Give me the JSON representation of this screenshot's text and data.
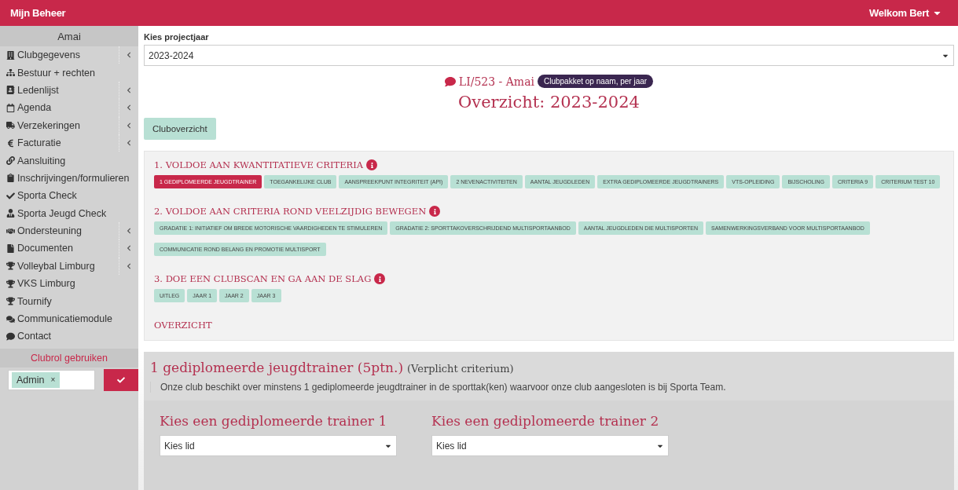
{
  "topbar": {
    "brand": "Mijn Beheer",
    "user": "Welkom Bert"
  },
  "sidebar": {
    "club": "Amai",
    "items": [
      {
        "label": "Clubgegevens",
        "expandable": true
      },
      {
        "label": "Bestuur + rechten",
        "expandable": false
      },
      {
        "label": "Ledenlijst",
        "expandable": true
      },
      {
        "label": "Agenda",
        "expandable": true
      },
      {
        "label": "Verzekeringen",
        "expandable": true
      },
      {
        "label": "Facturatie",
        "expandable": true
      },
      {
        "label": "Aansluiting",
        "expandable": false
      },
      {
        "label": "Inschrijvingen/formulieren",
        "expandable": false
      },
      {
        "label": "Sporta Check",
        "expandable": false
      },
      {
        "label": "Sporta Jeugd Check",
        "expandable": false
      },
      {
        "label": "Ondersteuning",
        "expandable": true
      },
      {
        "label": "Documenten",
        "expandable": true
      },
      {
        "label": "Volleybal Limburg",
        "expandable": true
      },
      {
        "label": "VKS Limburg",
        "expandable": false
      },
      {
        "label": "Tournify",
        "expandable": false
      },
      {
        "label": "Communicatiemodule",
        "expandable": false
      },
      {
        "label": "Contact",
        "expandable": false
      }
    ],
    "role": {
      "title": "Clubrol gebruiken",
      "tag": "Admin",
      "remove": "×"
    }
  },
  "year_select": {
    "label": "Kies projectjaar",
    "value": "2023-2024"
  },
  "club": {
    "code": "LI/523 - Amai",
    "badge": "Clubpakket op naam, per jaar",
    "title": "Overzicht: 2023-2024"
  },
  "overview_button": "Cluboverzicht",
  "sections": [
    {
      "title": "1. VOLDOE AAN KWANTITATIEVE CRITERIA",
      "info": true,
      "tags": [
        {
          "label": "1 GEDIPLOMEERDE JEUGDTRAINER",
          "selected": true
        },
        {
          "label": "TOEGANKELIJKE CLUB",
          "selected": false
        },
        {
          "label": "AANSPREEKPUNT INTEGRITEIT (API)",
          "selected": false
        },
        {
          "label": "2 NEVENACTIVITEITEN",
          "selected": false
        },
        {
          "label": "AANTAL JEUGDLEDEN",
          "selected": false
        },
        {
          "label": "EXTRA GEDIPLOMEERDE JEUGDTRAINERS",
          "selected": false
        },
        {
          "label": "VTS-OPLEIDING",
          "selected": false
        },
        {
          "label": "BIJSCHOLING",
          "selected": false
        },
        {
          "label": "CRITERIA 9",
          "selected": false
        },
        {
          "label": "CRITERIUM TEST 10",
          "selected": false
        }
      ]
    },
    {
      "title": "2. VOLDOE AAN CRITERIA ROND VEELZIJDIG BEWEGEN",
      "info": true,
      "tags": [
        {
          "label": "GRADATIE 1: INITIATIEF OM BREDE MOTORISCHE VAARDIGHEDEN TE STIMULEREN",
          "selected": false
        },
        {
          "label": "GRADATIE 2: SPORTTAKOVERSCHRIJDEND MULTISPORTAANBOD",
          "selected": false
        },
        {
          "label": "AANTAL JEUGDLEDEN DIE MULTISPORTEN",
          "selected": false
        },
        {
          "label": "SAMENWERKINGSVERBAND VOOR MULTISPORTAANBOD",
          "selected": false
        },
        {
          "label": "COMMUNICATIE ROND BELANG EN PROMOTIE MULTISPORT",
          "selected": false
        }
      ]
    },
    {
      "title": "3. DOE EEN CLUBSCAN EN GA AAN DE SLAG",
      "info": true,
      "tags": [
        {
          "label": "UITLEG",
          "selected": false
        },
        {
          "label": "JAAR 1",
          "selected": false
        },
        {
          "label": "JAAR 2",
          "selected": false
        },
        {
          "label": "JAAR 3",
          "selected": false
        }
      ]
    },
    {
      "title": "OVERZICHT",
      "info": false
    }
  ],
  "detail": {
    "title": "1 gediplomeerde jeugdtrainer (5ptn.)",
    "note": "(Verplicht criterium)",
    "description": "Onze club beschikt over minstens 1 gediplomeerde jeugdtrainer in de sporttak(ken) waarvoor onze club aangesloten is bij Sporta Team.",
    "pickers": [
      {
        "label": "Kies een gediplomeerde trainer 1",
        "value": "Kies lid"
      },
      {
        "label": "Kies een gediplomeerde trainer 2",
        "value": "Kies lid"
      }
    ]
  }
}
